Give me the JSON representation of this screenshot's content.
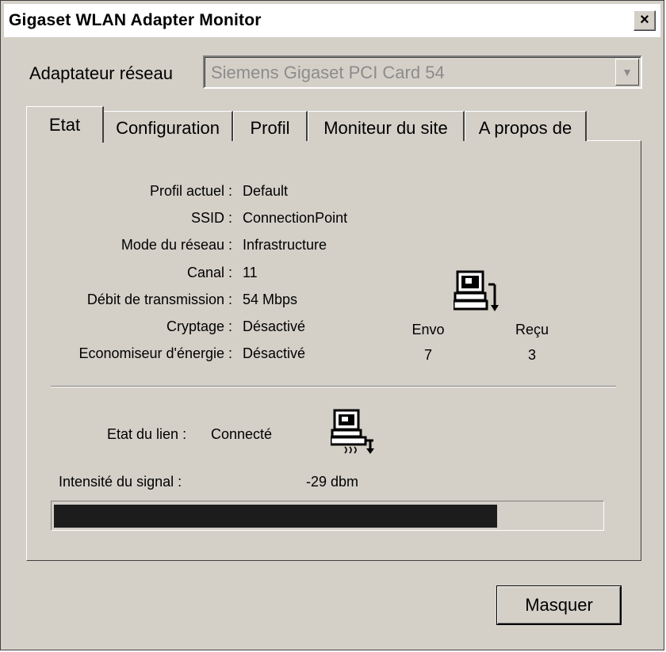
{
  "window": {
    "title": "Gigaset WLAN Adapter Monitor",
    "close_label": "×"
  },
  "adapter": {
    "label": "Adaptateur réseau",
    "selected": "Siemens Gigaset PCI Card 54"
  },
  "tabs": [
    {
      "label": "Etat",
      "active": true
    },
    {
      "label": "Configuration",
      "active": false
    },
    {
      "label": "Profil",
      "active": false
    },
    {
      "label": "Moniteur du site",
      "active": false
    },
    {
      "label": "A propos de",
      "active": false
    }
  ],
  "status": {
    "rows": [
      {
        "label": "Profil actuel :",
        "value": "Default"
      },
      {
        "label": "SSID :",
        "value": "ConnectionPoint"
      },
      {
        "label": "Mode du réseau :",
        "value": "Infrastructure"
      },
      {
        "label": "Canal :",
        "value": "11"
      },
      {
        "label": "Débit de transmission :",
        "value": "54 Mbps"
      },
      {
        "label": "Cryptage :",
        "value": "Désactivé"
      },
      {
        "label": "Economiseur d'énergie :",
        "value": "Désactivé"
      }
    ],
    "sent_label": "Envo",
    "received_label": "Reçu",
    "sent_value": "7",
    "received_value": "3"
  },
  "link": {
    "label": "Etat du lien :",
    "value": "Connecté",
    "signal_label": "Intensité du signal :",
    "signal_value": "-29 dbm",
    "signal_fraction": 0.81
  },
  "buttons": {
    "hide": "Masquer"
  },
  "icons": {
    "computer": "computer-network-icon",
    "link": "computer-link-icon"
  },
  "colors": {
    "signal_fill": "#1c1c1c",
    "face": "#d4d0c8"
  }
}
